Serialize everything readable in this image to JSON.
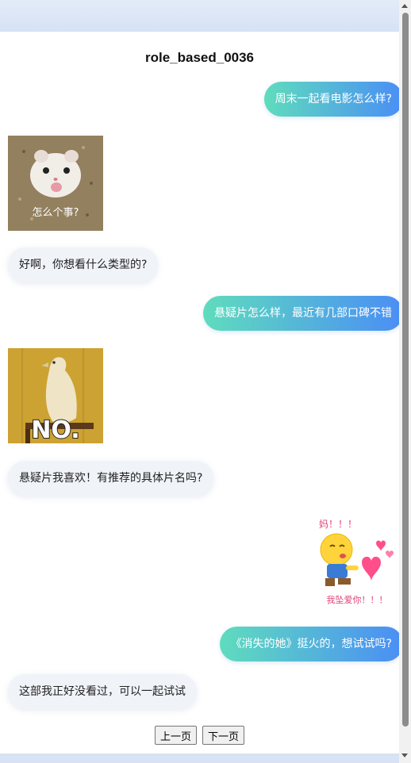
{
  "title": "role_based_0036",
  "messages": [
    {
      "role": "user",
      "text": "周末一起看电影怎么样?"
    },
    {
      "role": "bot",
      "sticker": "hamster-sticker",
      "caption": "怎么个事?"
    },
    {
      "role": "bot",
      "text": "好啊，你想看什么类型的?"
    },
    {
      "role": "user",
      "text": "悬疑片怎么样，最近有几部口碑不错"
    },
    {
      "role": "bot",
      "sticker": "bird-no-sticker",
      "caption": "NO."
    },
    {
      "role": "bot",
      "text": "悬疑片我喜欢！有推荐的具体片名吗?"
    },
    {
      "role": "user",
      "sticker": "love-emoji-sticker",
      "caption_top": "妈！！！",
      "caption_bottom": "我坠爱你！！！"
    },
    {
      "role": "user",
      "text": "《消失的她》挺火的，想试试吗?"
    },
    {
      "role": "bot",
      "text": "这部我正好没看过，可以一起试试"
    }
  ],
  "pager": {
    "prev": "上一页",
    "next": "下一页"
  },
  "colors": {
    "user_gradient_start": "#5fdcbd",
    "user_gradient_end": "#4a8ef5",
    "bot_bubble": "#f0f3f8"
  }
}
